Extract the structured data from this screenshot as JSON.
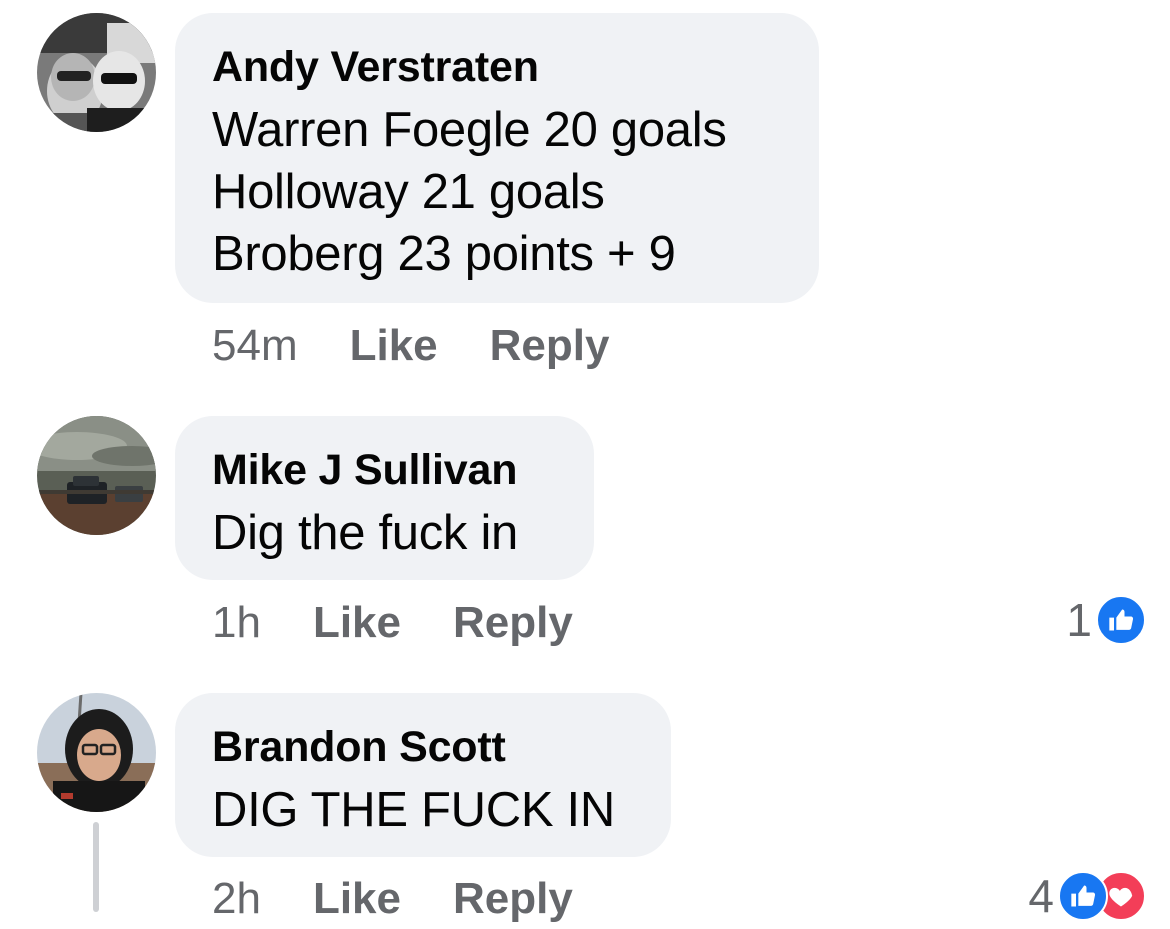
{
  "comments": [
    {
      "author": "Andy Verstraten",
      "lines": [
        "Warren Foegle 20 goals",
        "Holloway 21 goals",
        "Broberg 23 points + 9"
      ],
      "time": "54m",
      "like_label": "Like",
      "reply_label": "Reply"
    },
    {
      "author": "Mike J Sullivan",
      "lines": [
        "Dig the fuck in"
      ],
      "time": "1h",
      "like_label": "Like",
      "reply_label": "Reply",
      "reaction_count": "1"
    },
    {
      "author": "Brandon Scott",
      "lines": [
        "DIG THE FUCK IN"
      ],
      "time": "2h",
      "like_label": "Like",
      "reply_label": "Reply",
      "reaction_count": "4"
    }
  ],
  "colors": {
    "bubble": "#f0f2f5",
    "meta_text": "#65676b",
    "like_blue": "#1877f2",
    "love_red": "#f33e58",
    "thread_line": "#ced0d4"
  },
  "icons": {
    "like_reaction": "thumbs-up-icon",
    "love_reaction": "heart-icon"
  }
}
